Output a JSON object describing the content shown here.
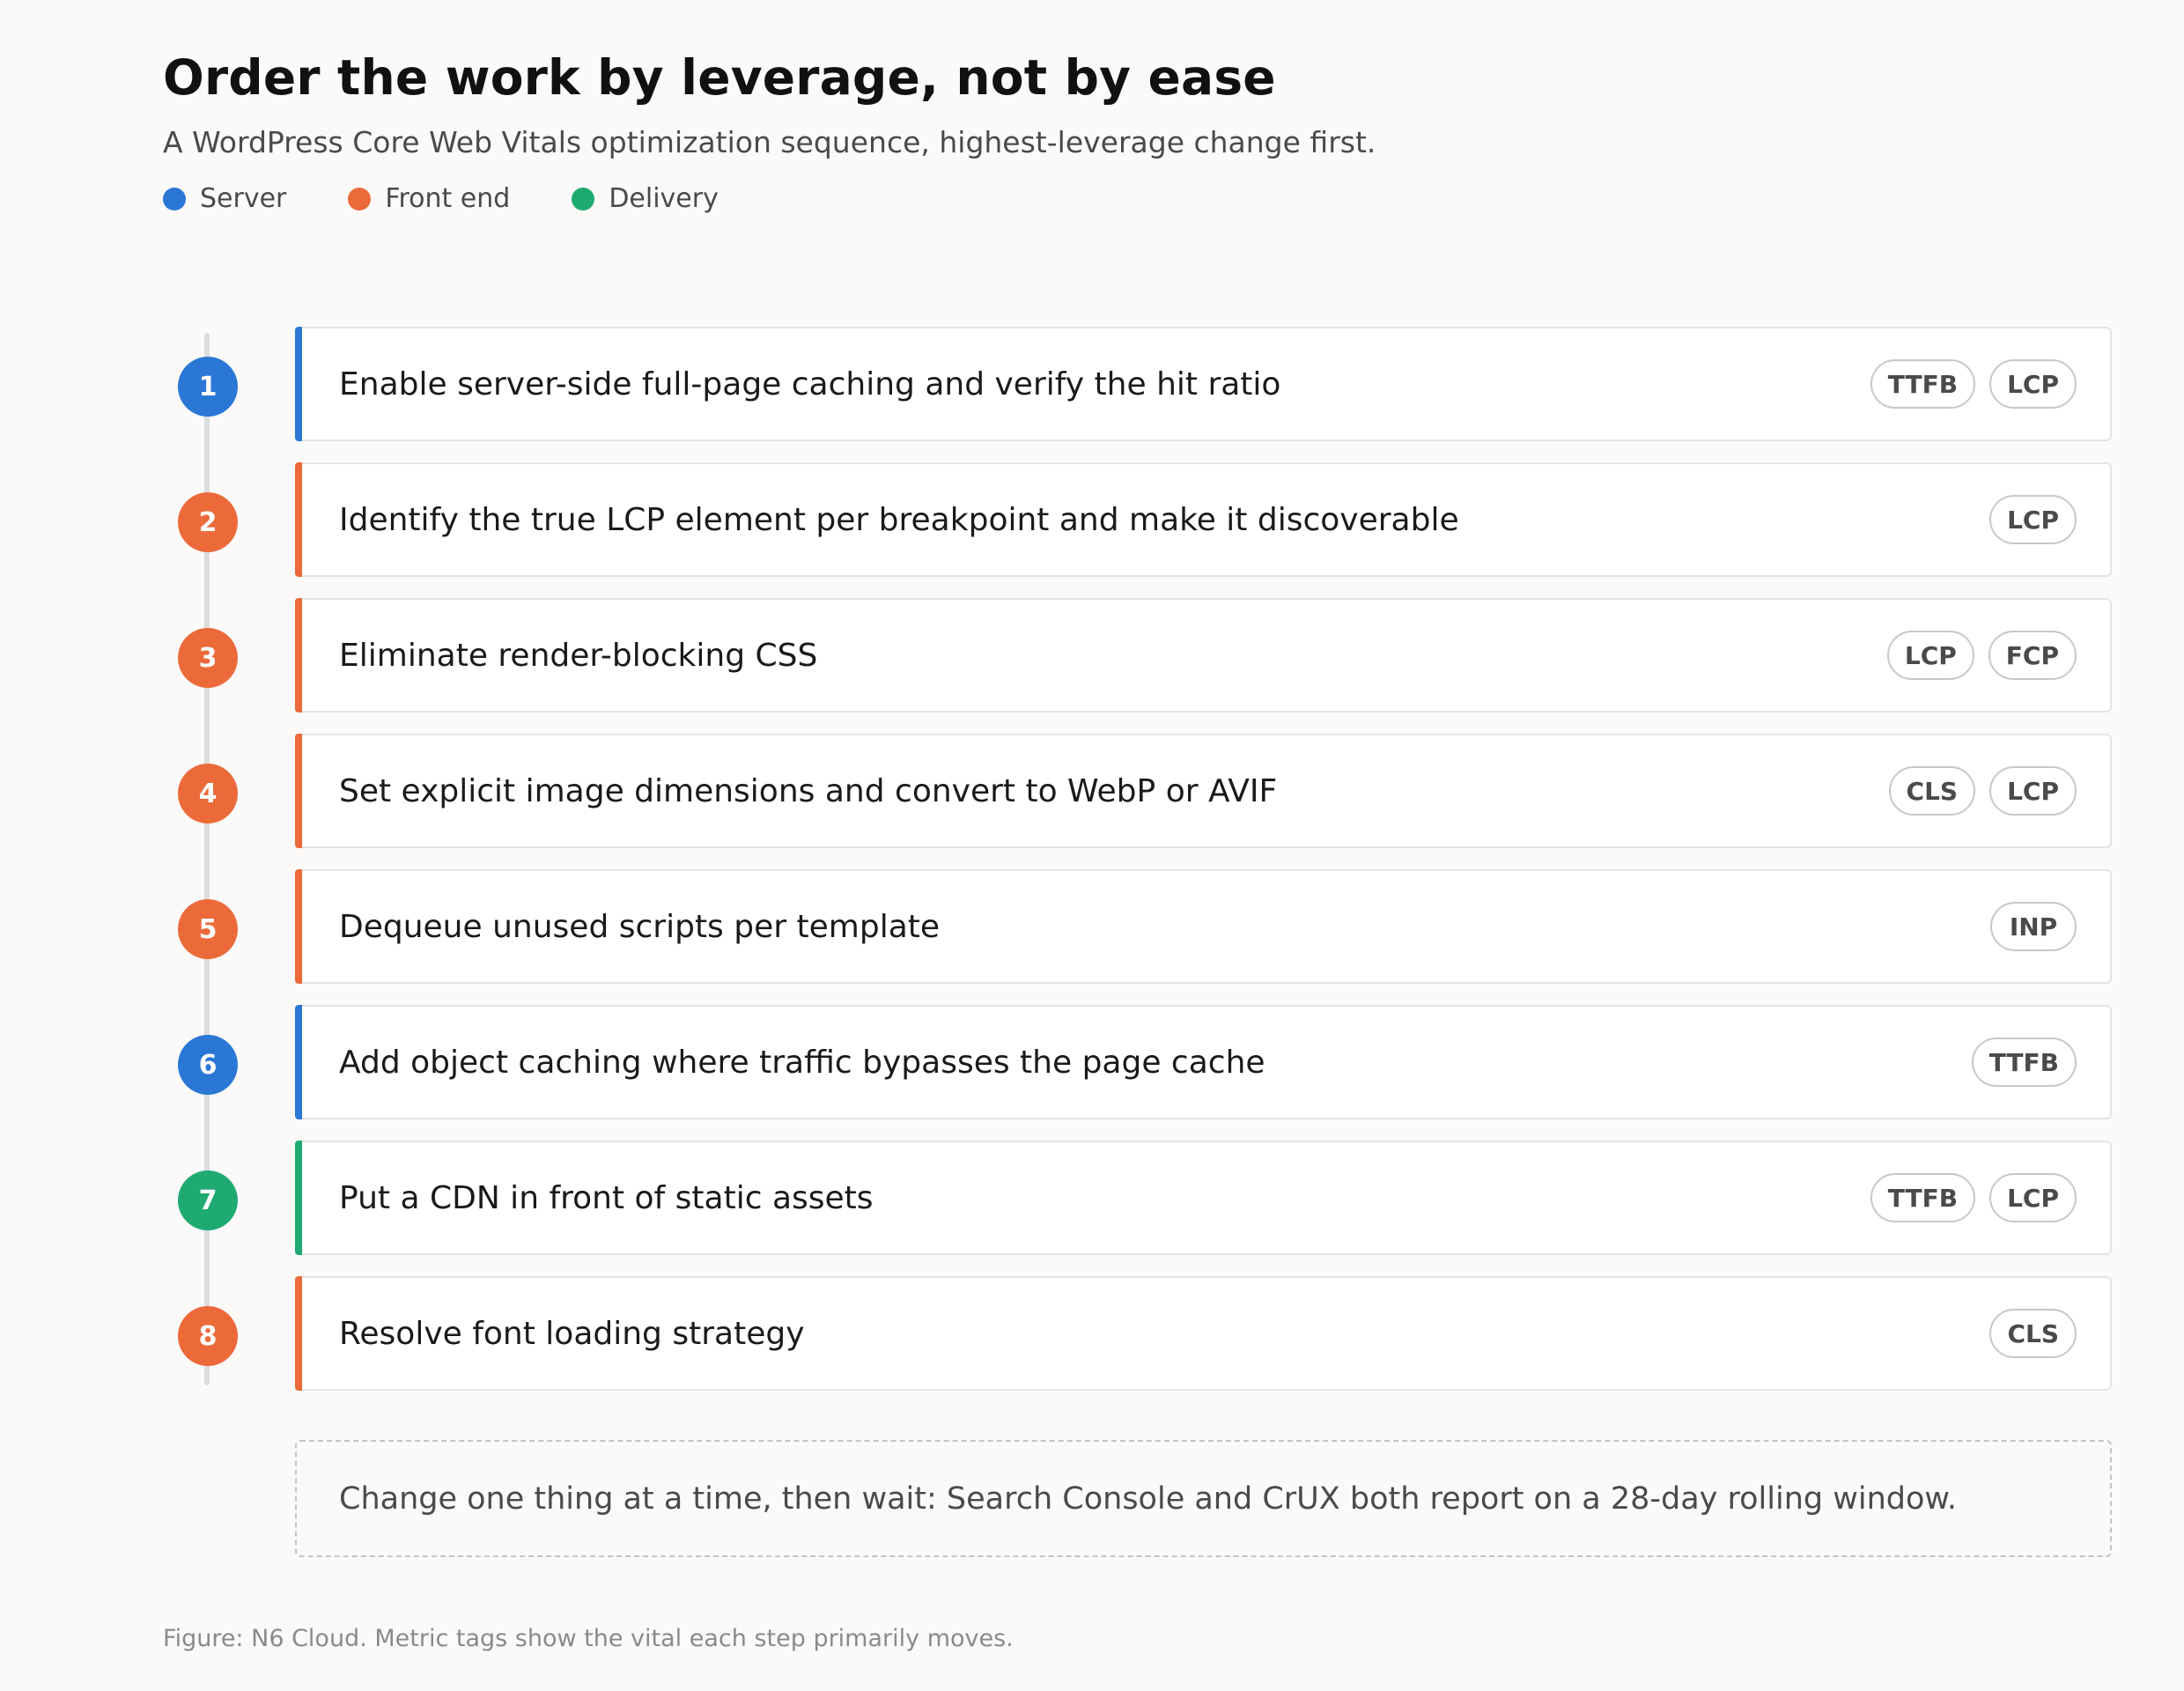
{
  "header": {
    "title": "Order the work by leverage, not by ease",
    "subtitle": "A WordPress Core Web Vitals optimization sequence, highest-leverage change first."
  },
  "colors": {
    "server": "#2a77d6",
    "front_end": "#ec6a3a",
    "delivery": "#1faa72"
  },
  "legend": [
    {
      "label": "Server",
      "category": "server"
    },
    {
      "label": "Front end",
      "category": "front_end"
    },
    {
      "label": "Delivery",
      "category": "delivery"
    }
  ],
  "steps": [
    {
      "number": "1",
      "category": "server",
      "text": "Enable server-side full-page caching and verify the hit ratio",
      "tags": [
        "TTFB",
        "LCP"
      ]
    },
    {
      "number": "2",
      "category": "front_end",
      "text": "Identify the true LCP element per breakpoint and make it discoverable",
      "tags": [
        "LCP"
      ]
    },
    {
      "number": "3",
      "category": "front_end",
      "text": "Eliminate render-blocking CSS",
      "tags": [
        "LCP",
        "FCP"
      ]
    },
    {
      "number": "4",
      "category": "front_end",
      "text": "Set explicit image dimensions and convert to WebP or AVIF",
      "tags": [
        "CLS",
        "LCP"
      ]
    },
    {
      "number": "5",
      "category": "front_end",
      "text": "Dequeue unused scripts per template",
      "tags": [
        "INP"
      ]
    },
    {
      "number": "6",
      "category": "server",
      "text": "Add object caching where traffic bypasses the page cache",
      "tags": [
        "TTFB"
      ]
    },
    {
      "number": "7",
      "category": "delivery",
      "text": "Put a CDN in front of static assets",
      "tags": [
        "TTFB",
        "LCP"
      ]
    },
    {
      "number": "8",
      "category": "front_end",
      "text": "Resolve font loading strategy",
      "tags": [
        "CLS"
      ]
    }
  ],
  "note": "Change one thing at a time, then wait: Search Console and CrUX both report on a 28-day rolling window.",
  "caption": "Figure: N6 Cloud. Metric tags show the vital each step primarily moves."
}
